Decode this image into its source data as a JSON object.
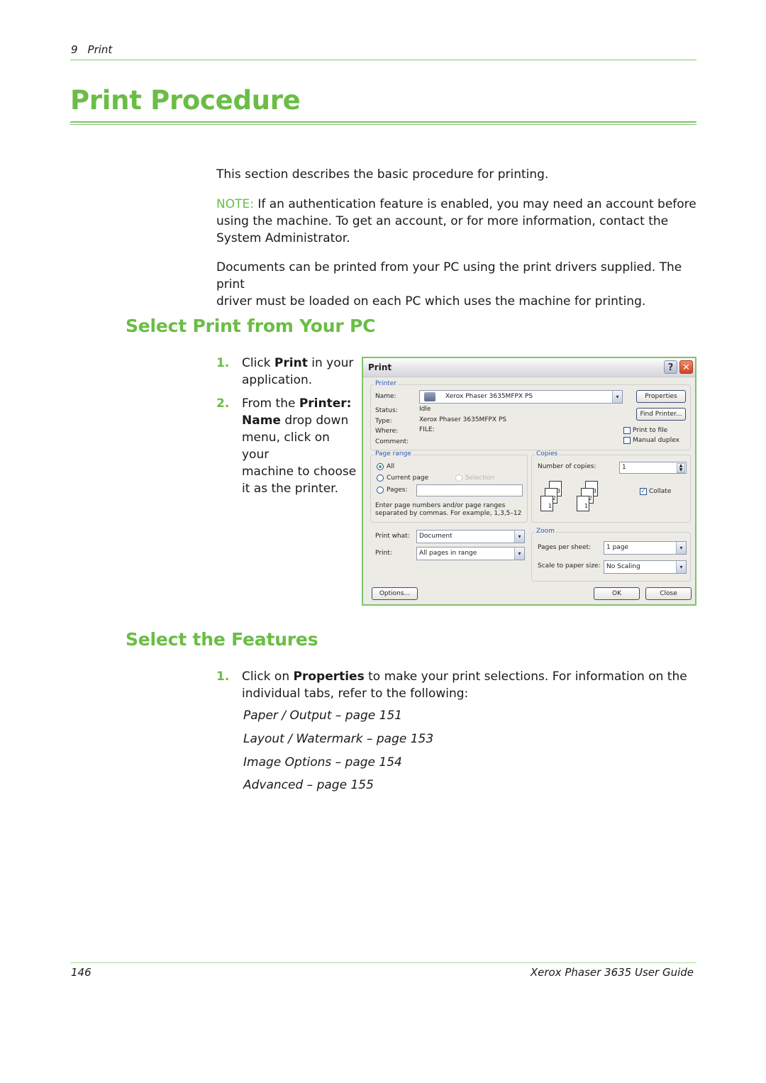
{
  "header": {
    "chapter_number": "9",
    "chapter_title": "Print"
  },
  "page_title": "Print Procedure",
  "intro": {
    "paragraph1": "This section describes the basic procedure for printing.",
    "note_label": "NOTE:",
    "note_text_line1": " If an authentication feature is enabled, you may need an account before",
    "note_text_line2": "using the machine. To get an account, or for more information, contact the",
    "note_text_line3": "System Administrator.",
    "paragraph2_line1": "Documents can be printed from your PC using the print drivers supplied. The print",
    "paragraph2_line2": "driver must be loaded on each PC which uses the machine for printing."
  },
  "section1": {
    "heading": "Select Print from Your PC",
    "steps": [
      {
        "number": "1.",
        "lines": [
          {
            "pre": "Click ",
            "bold": "Print",
            "post": " in your"
          },
          {
            "pre": "application.",
            "bold": "",
            "post": ""
          }
        ]
      },
      {
        "number": "2.",
        "lines": [
          {
            "pre": "From the ",
            "bold": "Printer:",
            "post": ""
          },
          {
            "pre": "",
            "bold": "Name",
            "post": " drop down"
          },
          {
            "pre": "menu, click on your",
            "bold": "",
            "post": ""
          },
          {
            "pre": "machine to choose",
            "bold": "",
            "post": ""
          },
          {
            "pre": "it as the printer.",
            "bold": "",
            "post": ""
          }
        ]
      }
    ]
  },
  "dialog": {
    "title": "Print",
    "help_glyph": "?",
    "close_glyph": "✕",
    "printer_group": {
      "legend": "Printer",
      "name_label": "Name:",
      "name_value": "Xerox Phaser 3635MFPX PS",
      "status_label": "Status:",
      "status_value": "Idle",
      "type_label": "Type:",
      "type_value": "Xerox Phaser 3635MFPX PS",
      "where_label": "Where:",
      "where_value": "FILE:",
      "comment_label": "Comment:",
      "comment_value": "",
      "properties_button": "Properties",
      "find_printer_button": "Find Printer...",
      "print_to_file_label": "Print to file",
      "print_to_file_checked": false,
      "manual_duplex_label": "Manual duplex",
      "manual_duplex_checked": false
    },
    "page_range_group": {
      "legend": "Page range",
      "options": [
        {
          "label": "All",
          "selected": true,
          "enabled": true
        },
        {
          "label": "Current page",
          "selected": false,
          "enabled": true
        },
        {
          "label": "Selection",
          "selected": false,
          "enabled": false
        },
        {
          "label": "Pages:",
          "selected": false,
          "enabled": true
        }
      ],
      "pages_value": "",
      "hint_line1": "Enter page numbers and/or page ranges",
      "hint_line2": "separated by commas.  For example, 1,3,5–12"
    },
    "copies_group": {
      "legend": "Copies",
      "number_label": "Number of copies:",
      "number_value": "1",
      "collate_label": "Collate",
      "collate_checked": true,
      "sheet_numbers": [
        "3",
        "2",
        "1"
      ]
    },
    "print_what_label": "Print what:",
    "print_what_value": "Document",
    "print_label": "Print:",
    "print_value": "All pages in range",
    "zoom_group": {
      "legend": "Zoom",
      "pages_per_sheet_label": "Pages per sheet:",
      "pages_per_sheet_value": "1 page",
      "scale_label": "Scale to paper size:",
      "scale_value": "No Scaling"
    },
    "options_button": "Options...",
    "ok_button": "OK",
    "close_button": "Close",
    "dropdown_glyph": "▾"
  },
  "section2": {
    "heading": "Select the Features",
    "step_number": "1.",
    "step_line1_pre": "Click on ",
    "step_line1_bold": "Properties",
    "step_line1_post": " to make your print selections. For information on the",
    "step_line2": "individual tabs, refer to the following:",
    "references": [
      "Paper / Output – page 151",
      "Layout / Watermark – page 153",
      "Image Options – page 154",
      "Advanced – page 155"
    ]
  },
  "footer": {
    "page_number": "146",
    "guide_title": "Xerox Phaser 3635 User Guide"
  }
}
